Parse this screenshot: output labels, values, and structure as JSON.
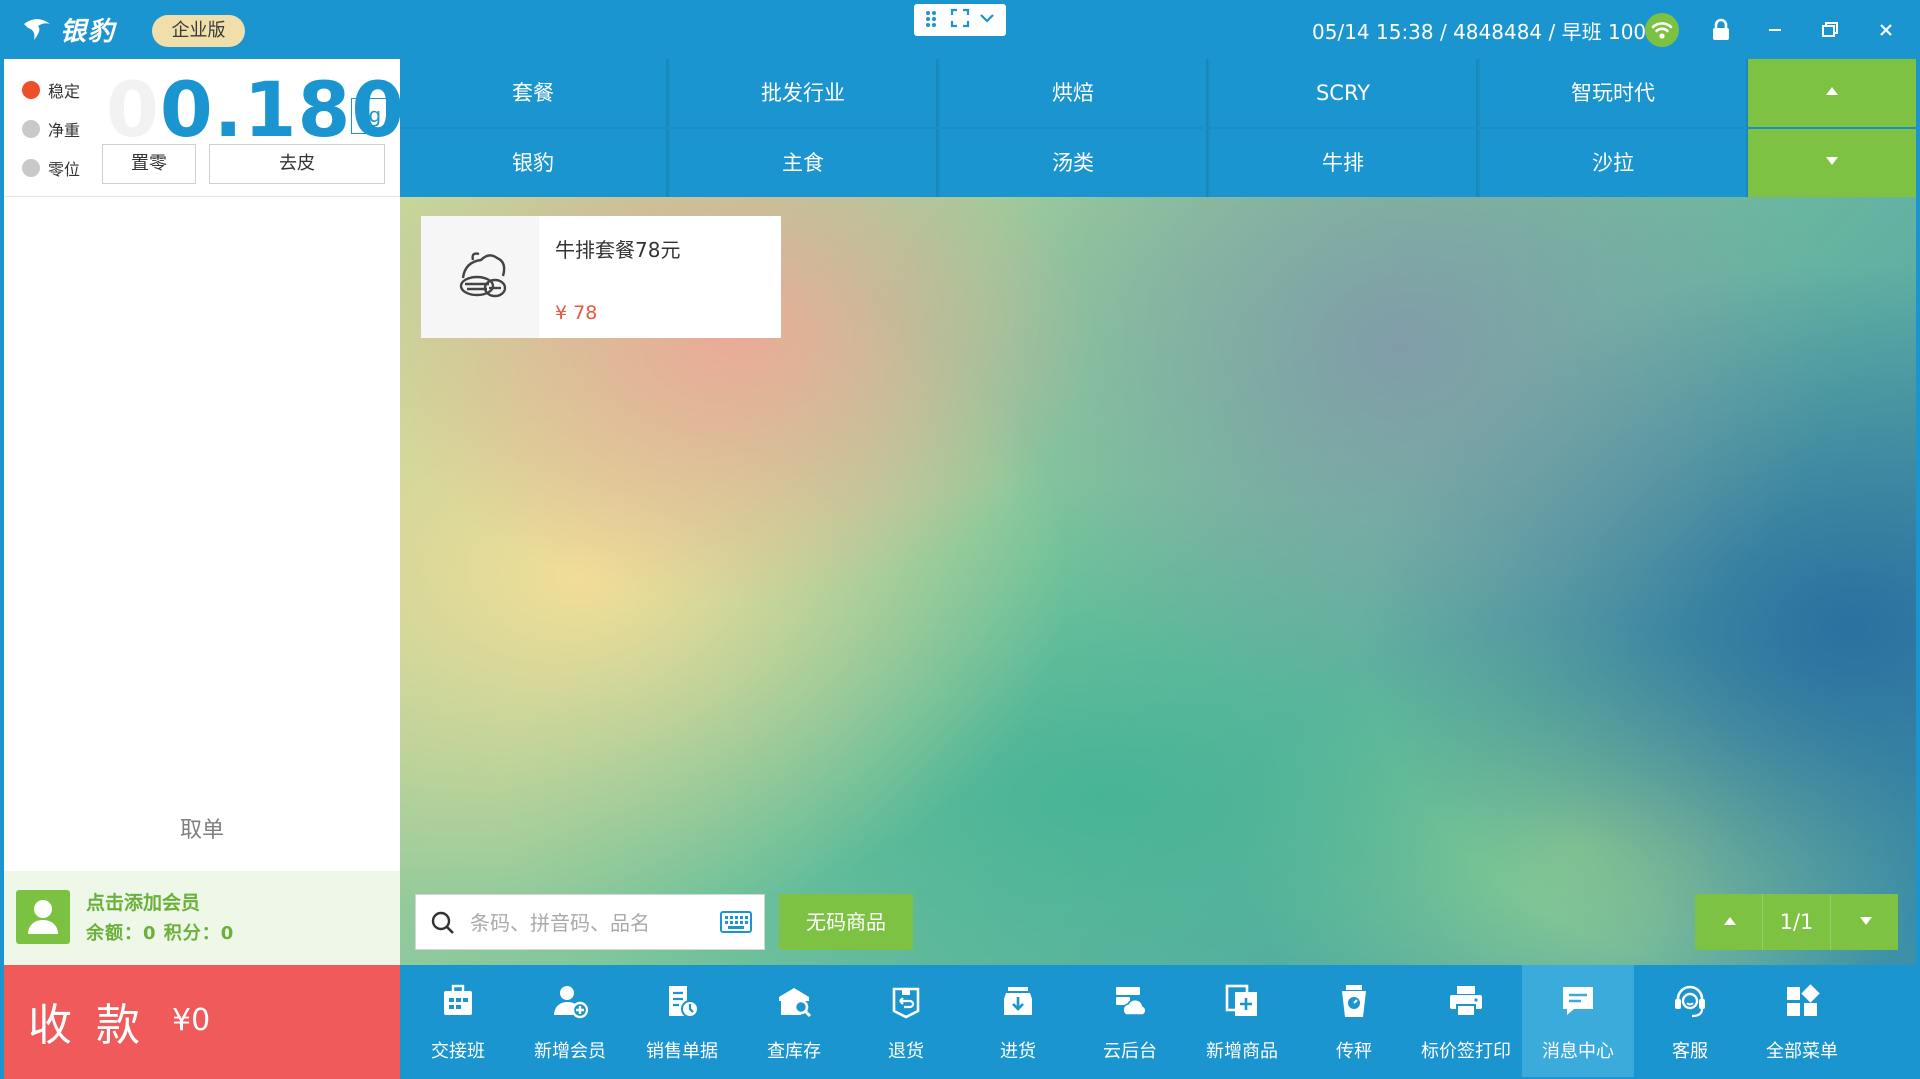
{
  "app": {
    "logo_text": "银豹",
    "edition": "企业版",
    "status_line": "05/14 15:38 / 4848484 / 早班 1001"
  },
  "scale": {
    "indicators": [
      "稳定",
      "净重",
      "零位"
    ],
    "weight": "0.180",
    "ghost_digit": "0",
    "unit": "kg",
    "zero_button": "置零",
    "tare_button": "去皮"
  },
  "order": {
    "cancel_label": "取单"
  },
  "member": {
    "add_label": "点击添加会员",
    "balance_line": "余额：0  积分：0"
  },
  "payment": {
    "label": "收款",
    "amount": "¥0"
  },
  "categories": {
    "row1": [
      "套餐",
      "批发行业",
      "烘焙",
      "SCRY",
      "智玩时代"
    ],
    "row2": [
      "银豹",
      "主食",
      "汤类",
      "牛排",
      "沙拉"
    ]
  },
  "products": [
    {
      "name": "牛排套餐78元",
      "price": "¥ 78"
    }
  ],
  "search": {
    "placeholder": "条码、拼音码、品名",
    "value": ""
  },
  "no_code_button": "无码商品",
  "pager": {
    "page": "1/1"
  },
  "toolbar": [
    {
      "label": "交接班",
      "icon": "handover-icon"
    },
    {
      "label": "新增会员",
      "icon": "add-member-icon"
    },
    {
      "label": "销售单据",
      "icon": "sales-receipt-icon"
    },
    {
      "label": "查库存",
      "icon": "inventory-search-icon"
    },
    {
      "label": "退货",
      "icon": "return-icon"
    },
    {
      "label": "进货",
      "icon": "stock-in-icon"
    },
    {
      "label": "云后台",
      "icon": "cloud-backend-icon"
    },
    {
      "label": "新增商品",
      "icon": "add-product-icon"
    },
    {
      "label": "传秤",
      "icon": "scale-transfer-icon"
    },
    {
      "label": "标价签打印",
      "icon": "printer-icon"
    },
    {
      "label": "消息中心",
      "icon": "message-icon",
      "active": true
    },
    {
      "label": "客服",
      "icon": "support-icon"
    },
    {
      "label": "全部菜单",
      "icon": "all-menu-icon"
    }
  ],
  "colors": {
    "primary": "#1b95cf",
    "accent_green": "#7dc242",
    "pay_red": "#f05a5a",
    "price_red": "#e55a3c"
  }
}
